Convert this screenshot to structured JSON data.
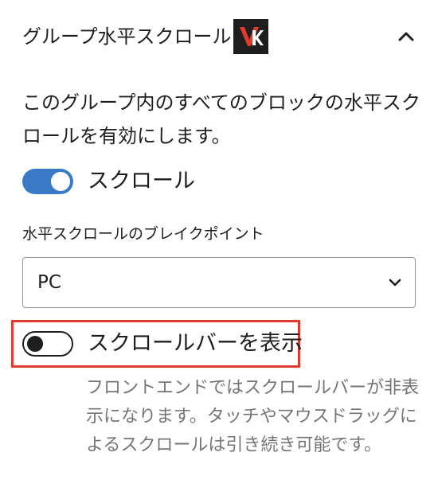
{
  "panel": {
    "title": "グループ水平スクロール",
    "logo_icon": "vk-brand-logo",
    "collapse_icon": "chevron-up-icon"
  },
  "description": "このグループ内のすべてのブロックの水平スクロールを有効にします。",
  "scroll_toggle": {
    "label": "スクロール",
    "checked": true,
    "accent_color": "#3a7bc8"
  },
  "breakpoint": {
    "label": "水平スクロールのブレイクポイント",
    "selected": "PC",
    "dropdown_icon": "chevron-down-icon"
  },
  "scrollbar_toggle": {
    "label": "スクロールバーを表示",
    "checked": false,
    "help": "フロントエンドではスクロールバーが非表示になります。タッチやマウスドラッグによるスクロールは引き続き可能です。",
    "highlight_color": "#e03b2e"
  }
}
